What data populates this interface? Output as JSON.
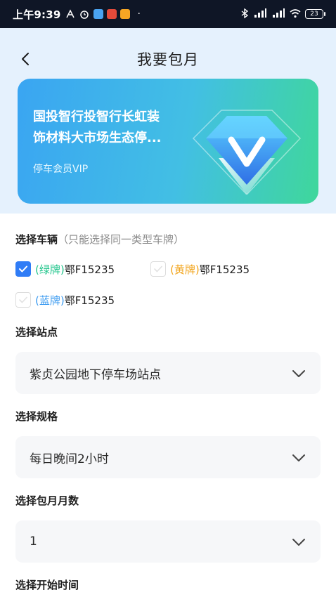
{
  "status_bar": {
    "time": "上午9:39",
    "dot": "·",
    "battery": "23"
  },
  "header": {
    "title": "我要包月",
    "back_icon": "chevron-left-icon"
  },
  "vip_card": {
    "name": "国投智行投智行长虹装饰材料大市场生态停...",
    "name_line1": "国投智行投智行长虹装",
    "name_line2": "饰材料大市场生态停...",
    "subtitle": "停车会员VIP",
    "icon": "diamond-icon"
  },
  "form": {
    "vehicle": {
      "label": "选择车辆",
      "hint": "（只能选择同一类型车牌）",
      "plates": [
        {
          "type": "(绿牌)",
          "number": "鄂F15235",
          "checked": true
        },
        {
          "type": "(黄牌)",
          "number": "鄂F15235",
          "checked": false
        },
        {
          "type": "(蓝牌)",
          "number": "鄂F15235",
          "checked": false
        }
      ]
    },
    "station": {
      "label": "选择站点",
      "value": "紫贞公园地下停车场站点"
    },
    "spec": {
      "label": "选择规格",
      "value": "每日晚间2小时"
    },
    "months": {
      "label": "选择包月月数",
      "value": "1"
    },
    "start_time": {
      "label": "选择开始时间"
    }
  },
  "colors": {
    "accent": "#2f7cf6",
    "green_plate": "#1ec48a",
    "yellow_plate": "#f2a318",
    "blue_plate": "#3a9af0"
  }
}
